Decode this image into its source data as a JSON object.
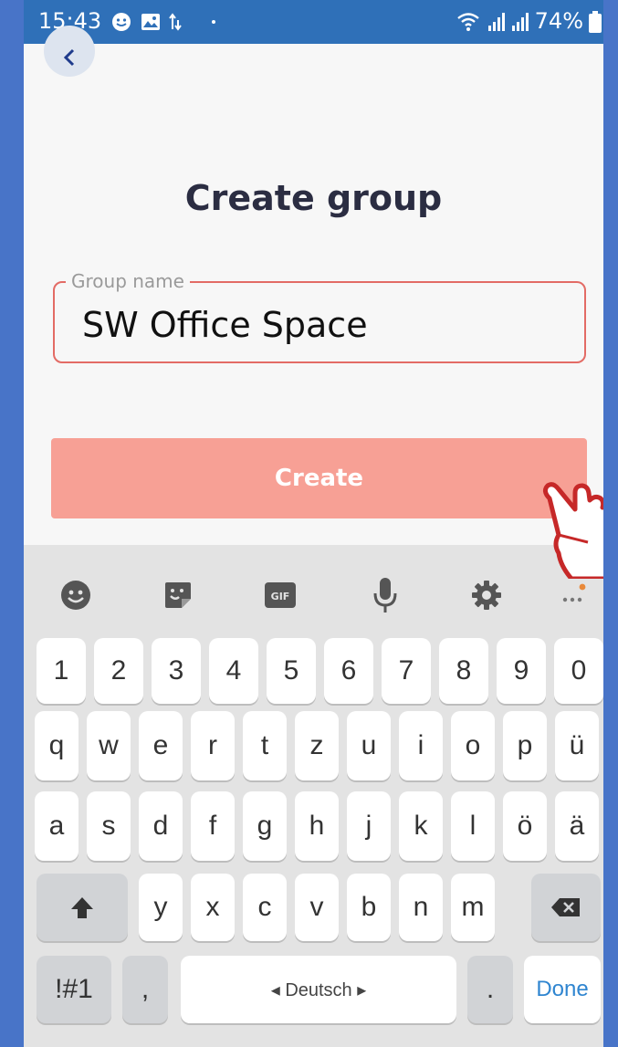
{
  "status_bar": {
    "time": "15:43",
    "battery": "74%"
  },
  "screen": {
    "title": "Create group"
  },
  "group_name": {
    "label": "Group name",
    "value": "SW Office Space"
  },
  "actions": {
    "create_label": "Create"
  },
  "keyboard": {
    "number_row": [
      "1",
      "2",
      "3",
      "4",
      "5",
      "6",
      "7",
      "8",
      "9",
      "0"
    ],
    "row1": [
      "q",
      "w",
      "e",
      "r",
      "t",
      "z",
      "u",
      "i",
      "o",
      "p",
      "ü"
    ],
    "row2": [
      "a",
      "s",
      "d",
      "f",
      "g",
      "h",
      "j",
      "k",
      "l",
      "ö",
      "ä"
    ],
    "row3": [
      "y",
      "x",
      "c",
      "v",
      "b",
      "n",
      "m"
    ],
    "symbols_label": "!#1",
    "comma": ",",
    "space_label": "◂ Deutsch ▸",
    "period": ".",
    "done_label": "Done",
    "gif_label": "GIF"
  }
}
